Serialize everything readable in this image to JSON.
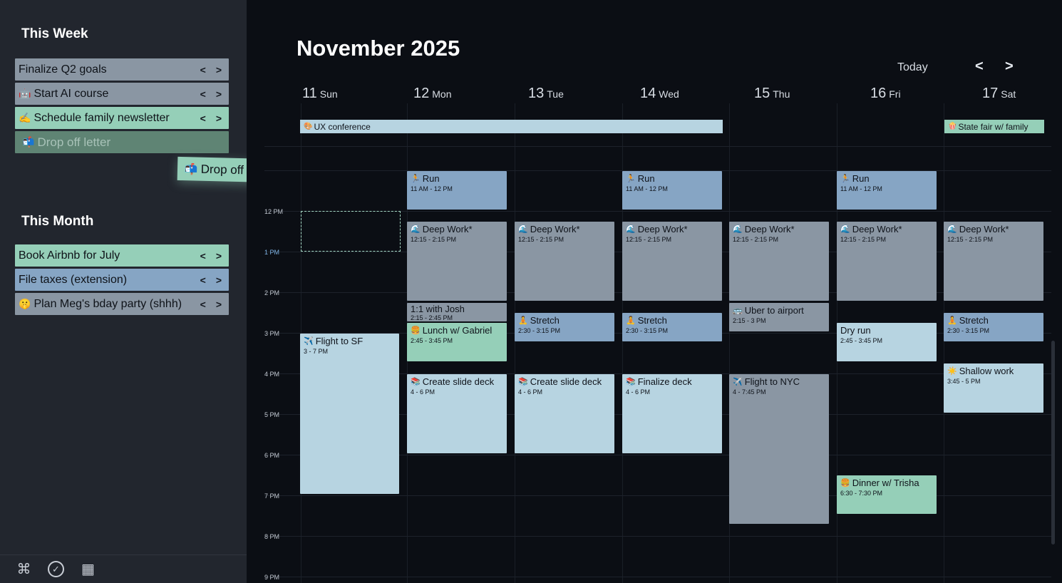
{
  "sidebar": {
    "this_week": {
      "title": "This Week",
      "tasks": [
        {
          "emoji": "",
          "label": "Finalize Q2 goals"
        },
        {
          "emoji": "🤖",
          "label": "Start AI course"
        },
        {
          "emoji": "✍️",
          "label": "Schedule family newsletter"
        },
        {
          "emoji": "📬",
          "label": "Drop off letter"
        }
      ]
    },
    "dragging": {
      "emoji": "📬",
      "label": "Drop off letter",
      "hand": "✋"
    },
    "this_month": {
      "title": "This Month",
      "tasks": [
        {
          "emoji": "",
          "label": "Book Airbnb for July"
        },
        {
          "emoji": "",
          "label": "File taxes (extension)"
        },
        {
          "emoji": "🤫",
          "label": "Plan Meg's bday party (shhh)"
        }
      ]
    },
    "arrows": {
      "prev": "<",
      "next": ">"
    },
    "bottom_icons": [
      "command-icon",
      "check-circle-icon",
      "calendar-icon"
    ],
    "bottom_glyphs": {
      "command": "⌘",
      "check": "✓",
      "calendar": "▦"
    }
  },
  "calendar": {
    "month_title": "November 2025",
    "today_label": "Today",
    "prev": "<",
    "next": ">",
    "days": [
      {
        "num": "11",
        "name": "Sun"
      },
      {
        "num": "12",
        "name": "Mon"
      },
      {
        "num": "13",
        "name": "Tue"
      },
      {
        "num": "14",
        "name": "Wed"
      },
      {
        "num": "15",
        "name": "Thu"
      },
      {
        "num": "16",
        "name": "Fri"
      },
      {
        "num": "17",
        "name": "Sat"
      }
    ],
    "hours": [
      "12 PM",
      "1 PM",
      "2 PM",
      "3 PM",
      "4 PM",
      "5 PM",
      "6 PM",
      "7 PM",
      "8 PM",
      "9 PM"
    ],
    "current_hour": "1 PM",
    "allday": [
      {
        "emoji": "🎨",
        "title": "UX conference"
      },
      {
        "emoji": "🍿",
        "title": "State fair w/ family"
      }
    ],
    "events": {
      "run": {
        "emoji": "🏃",
        "title": "Run",
        "time": "11 AM - 12 PM"
      },
      "deep_work": {
        "emoji": "🌊",
        "title": "Deep Work*",
        "time": "12:15 - 2:15 PM"
      },
      "stretch": {
        "emoji": "🧘",
        "title": "Stretch",
        "time": "2:30 - 3:15 PM"
      },
      "one_on_one": {
        "title": "1:1 with Josh",
        "time": "2:15 - 2:45 PM"
      },
      "lunch": {
        "emoji": "🍔",
        "title": "Lunch w/ Gabriel",
        "time": "2:45 - 3:45 PM"
      },
      "flight_sf": {
        "emoji": "✈️",
        "title": "Flight to SF",
        "time": "3 - 7 PM"
      },
      "create_deck": {
        "emoji": "📚",
        "title": "Create slide deck",
        "time": "4 - 6 PM"
      },
      "finalize_deck": {
        "emoji": "📚",
        "title": "Finalize deck",
        "time": "4 - 6 PM"
      },
      "uber": {
        "emoji": "🚌",
        "title": "Uber to airport",
        "time": "2:15 - 3 PM"
      },
      "flight_nyc": {
        "emoji": "✈️",
        "title": "Flight to NYC",
        "time": "4 - 7:45 PM"
      },
      "dry_run": {
        "title": "Dry run",
        "time": "2:45 - 3:45 PM"
      },
      "dinner": {
        "emoji": "🍔",
        "title": "Dinner w/ Trisha",
        "time": "6:30 - 7:30 PM"
      },
      "shallow": {
        "emoji": "☀️",
        "title": "Shallow work",
        "time": "3:45 - 5 PM"
      }
    }
  },
  "colors": {
    "task_grey": "#8a96a3",
    "task_green": "#95cfb8",
    "task_blue": "#86a5c4",
    "event_light": "#b7d4e1",
    "background": "#0b0e14",
    "sidebar": "#22262e"
  }
}
